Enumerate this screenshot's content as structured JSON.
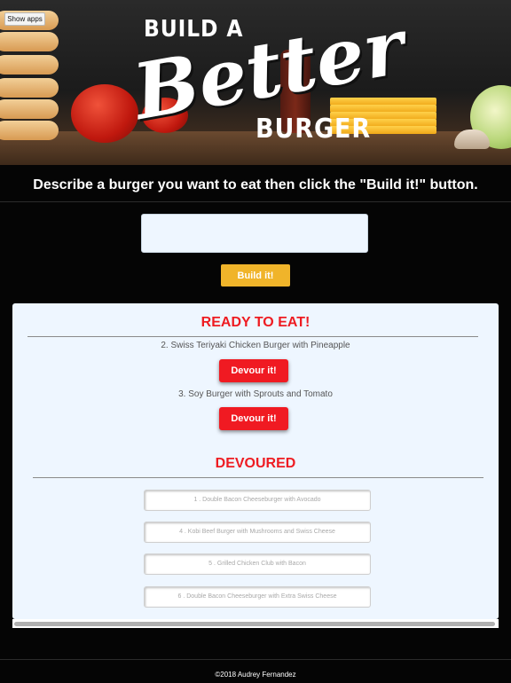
{
  "header": {
    "show_apps_label": "Show apps",
    "logo_line1": "BUILD A",
    "logo_script": "Better",
    "logo_line2": "BURGER"
  },
  "instruction": "Describe a burger you want to eat then click the \"Build it!\" button.",
  "form": {
    "input_value": "",
    "build_label": "Build it!"
  },
  "ready": {
    "title": "READY TO EAT!",
    "items": [
      {
        "text": "2. Swiss Teriyaki Chicken Burger with Pineapple",
        "button": "Devour it!"
      },
      {
        "text": "3. Soy Burger with Sprouts and Tomato",
        "button": "Devour it!"
      }
    ]
  },
  "devoured": {
    "title": "DEVOURED",
    "items": [
      "1 . Double Bacon Cheeseburger with Avocado",
      "4 . Kobi Beef Burger with Mushrooms and Swiss Cheese",
      "5 . Grilled Chicken Club with Bacon",
      "6 . Double Bacon Cheeseburger with Extra Swiss Cheese"
    ]
  },
  "footer": {
    "text": "©2018 Audrey Fernandez"
  },
  "colors": {
    "accent_red": "#ee1c22",
    "button_yellow": "#f0b42a",
    "panel_bg": "#eef6ff",
    "page_bg": "#050505"
  }
}
